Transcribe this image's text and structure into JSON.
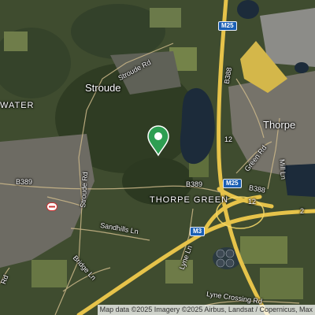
{
  "map": {
    "type": "satellite",
    "pin_color": "#2e9e52"
  },
  "places": {
    "stroude": "Stroude",
    "thorpe": "Thorpe",
    "thorpe_green": "THORPE GREEN",
    "water": "WATER"
  },
  "roads": {
    "stroude_rd_north": "Stroude Rd",
    "stroude_rd_west": "Stroude Rd",
    "green_rd": "Green Rd",
    "mill_ln": "Mill Ln",
    "sandhills_ln": "Sandhills Ln",
    "bridge_ln": "Bridge Ln",
    "lyne_ln": "Lyne Ln",
    "lyne_crossing_rd": "Lyne Crossing Rd",
    "rd_left": "Rd",
    "b389_left": "B389",
    "b389_center": "B389",
    "b388_center": "B388",
    "b388_top": "B388",
    "num_12": "12",
    "num_12_b": "12",
    "num_2": "2"
  },
  "shields": {
    "m25_top": "M25",
    "m25_mid": "M25",
    "m3": "M3"
  },
  "attribution": "Map data ©2025 Imagery ©2025 Airbus, Landsat / Copernicus, Max"
}
